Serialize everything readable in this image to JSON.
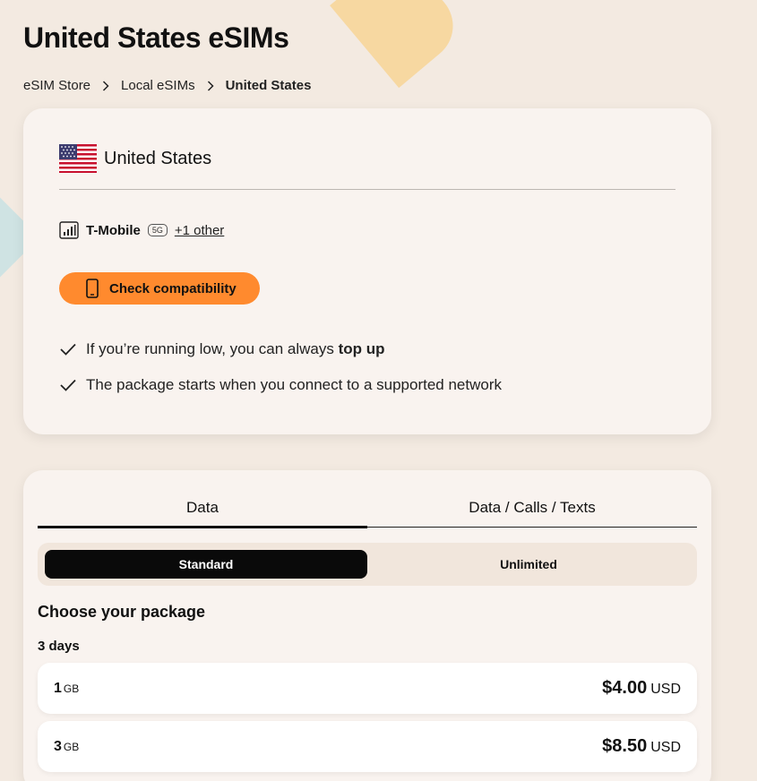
{
  "page": {
    "title": "United States eSIMs"
  },
  "breadcrumb": [
    "eSIM Store",
    "Local eSIMs",
    "United States"
  ],
  "country": {
    "name": "United States",
    "flag_icon": "us-flag-icon",
    "carrier": "T-Mobile",
    "network_badge": "5G",
    "other_networks": "+1 other"
  },
  "compatibility": {
    "label": "Check compatibility",
    "icon": "phone-icon"
  },
  "features": {
    "topup_prefix": "If you’re running low, you can always ",
    "topup_bold": "top up",
    "start_note": "The package starts when you connect to a supported network"
  },
  "tabs": [
    {
      "label": "Data",
      "active": true
    },
    {
      "label": "Data / Calls / Texts",
      "active": false
    }
  ],
  "plan_type": [
    {
      "label": "Standard",
      "active": true
    },
    {
      "label": "Unlimited",
      "active": false
    }
  ],
  "packages_section": {
    "title": "Choose your package",
    "duration": "3 days",
    "items": [
      {
        "size": "1",
        "unit": "GB",
        "price": "$4.00",
        "currency": "USD"
      },
      {
        "size": "3",
        "unit": "GB",
        "price": "$8.50",
        "currency": "USD"
      }
    ]
  },
  "colors": {
    "accent": "#ff8a2e",
    "background": "#f3eae1",
    "card": "#f9f3ef"
  }
}
